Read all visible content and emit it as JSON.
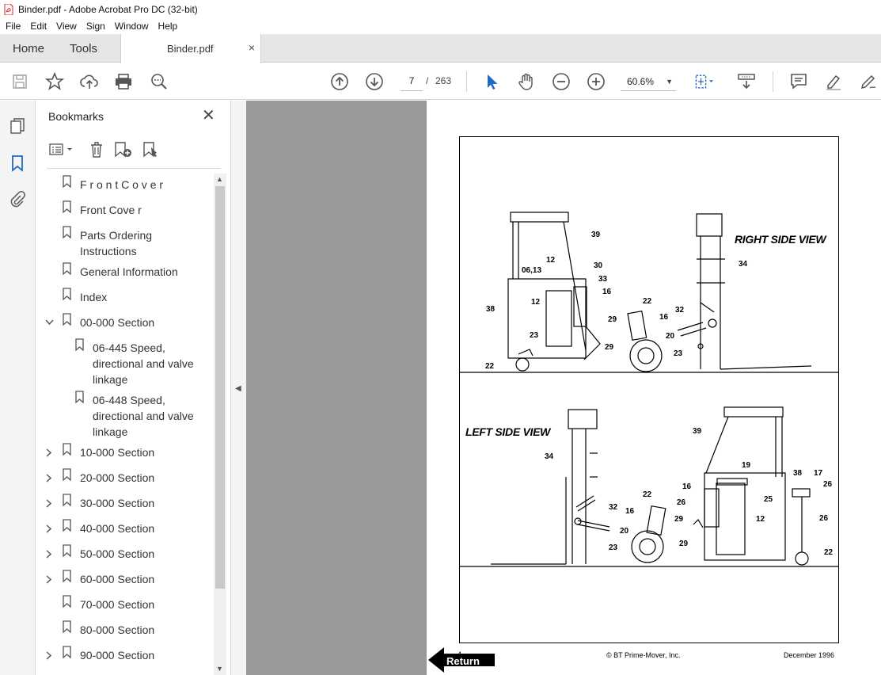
{
  "window": {
    "title": "Binder.pdf - Adobe Acrobat Pro DC (32-bit)"
  },
  "menu": [
    "File",
    "Edit",
    "View",
    "Sign",
    "Window",
    "Help"
  ],
  "tabs": {
    "home": "Home",
    "tools": "Tools",
    "document": "Binder.pdf",
    "close": "×"
  },
  "toolbar": {
    "page_current": "7",
    "page_sep": "/",
    "page_total": "263",
    "zoom": "60.6%"
  },
  "bookmarks": {
    "title": "Bookmarks",
    "close": "✕",
    "items": [
      {
        "label": "F r o n t C o v e r",
        "expandable": false,
        "indent": 0
      },
      {
        "label": "Front Cove r",
        "expandable": false,
        "indent": 0
      },
      {
        "label": "Parts Ordering Instructions",
        "line1": "Parts Ordering",
        "line2": "Instructions",
        "expandable": false,
        "indent": 0
      },
      {
        "label": "General Information",
        "expandable": false,
        "indent": 0
      },
      {
        "label": "Index",
        "expandable": false,
        "indent": 0
      },
      {
        "label": "00-000 Section",
        "expandable": true,
        "expanded": true,
        "indent": 0
      },
      {
        "label": "06-445 Speed, directional and valve linkage",
        "line1": "06-445 Speed,",
        "line2": "directional and valve",
        "line3": "linkage",
        "indent": 1
      },
      {
        "label": "06-448 Speed, directional and valve linkage",
        "line1": "06-448 Speed,",
        "line2": "directional and valve",
        "line3": "linkage",
        "indent": 1
      },
      {
        "label": "10-000 Section",
        "expandable": true
      },
      {
        "label": "20-000 Section",
        "expandable": true
      },
      {
        "label": "30-000 Section",
        "expandable": true
      },
      {
        "label": "40-000 Section",
        "expandable": true
      },
      {
        "label": "50-000 Section",
        "expandable": true
      },
      {
        "label": "60-000 Section",
        "expandable": true
      },
      {
        "label": "70-000 Section",
        "expandable": false
      },
      {
        "label": "80-000 Section",
        "expandable": false
      },
      {
        "label": "90-000 Section",
        "expandable": true
      }
    ]
  },
  "page": {
    "right_view_label": "RIGHT SIDE VIEW",
    "left_view_label": "LEFT SIDE VIEW",
    "footer_left": "4",
    "footer_center": "© BT Prime-Mover, Inc.",
    "footer_right": "December 1996",
    "return_label": "Return",
    "part_numbers_top": [
      "39",
      "12",
      "30",
      "06,13",
      "33",
      "16",
      "38",
      "12",
      "29",
      "23",
      "29",
      "22",
      "22",
      "16",
      "20",
      "23",
      "32",
      "34"
    ],
    "part_numbers_bottom": [
      "34",
      "32",
      "22",
      "16",
      "20",
      "23",
      "39",
      "19",
      "16",
      "26",
      "25",
      "38",
      "17",
      "26",
      "29",
      "12",
      "26",
      "29",
      "22"
    ]
  }
}
